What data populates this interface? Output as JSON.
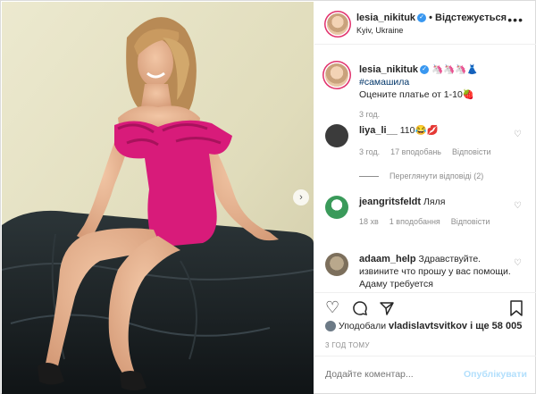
{
  "post": {
    "author": "lesia_nikituk",
    "follow_label": "• Відстежується",
    "location": "Kyiv, Ukraine",
    "more_glyph": "•••",
    "verified_glyph": "✓"
  },
  "caption": {
    "author": "lesia_nikituk",
    "emoji": "🦄🦄🦄👗",
    "hashtag": "#самашила",
    "text": "Оцените платье от 1-10🍓",
    "time": "3 год."
  },
  "comments": [
    {
      "author": "liya_li__",
      "text": "110😂💋",
      "time": "3 год.",
      "likes": "17 вподобань",
      "reply": "Відповісти",
      "view_replies": "Переглянути відповіді (2)"
    },
    {
      "author": "jeangritsfeldt",
      "text": "Ляля",
      "time": "18 хв",
      "likes": "1 вподобання",
      "reply": "Відповісти"
    },
    {
      "author": "adaam_help",
      "text": "Здравствуйте. извините что прошу у вас помощи. Адаму требуется"
    }
  ],
  "likes_line": {
    "prefix": "Уподобали ",
    "user": "vladislavtsvitkov",
    "rest": " і ще 58 005"
  },
  "posted_time": "3 ГОД ТОМУ",
  "add_comment": {
    "placeholder": "Додайте коментар...",
    "publish": "Опублікувати"
  },
  "icons": {
    "heart": "heart-icon",
    "comment": "comment-icon",
    "share": "share-icon",
    "save": "bookmark-icon",
    "next": "chevron-right-icon"
  },
  "colors": {
    "dress": "#d81b7a",
    "sofa": "#1b2124",
    "verified": "#3897f0",
    "publish": "#b2dffc"
  }
}
